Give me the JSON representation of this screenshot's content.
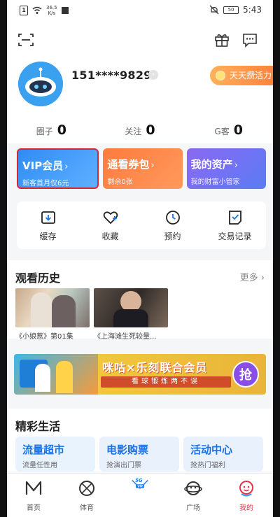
{
  "status_bar": {
    "sim": "1",
    "net_speed": "36.5\nK/s",
    "battery": "50",
    "time": "5:43"
  },
  "header": {
    "phone": "151****9829",
    "activity_label": "天天攒活力",
    "stats": [
      {
        "label": "圈子",
        "value": "0"
      },
      {
        "label": "关注",
        "value": "0"
      },
      {
        "label": "G客",
        "value": "0"
      }
    ]
  },
  "cards": [
    {
      "title": "VIP会员",
      "sub": "新客首月仅6元"
    },
    {
      "title": "通看券包",
      "sub": "剩余0张"
    },
    {
      "title": "我的资产",
      "sub": "我的财富小管家"
    }
  ],
  "quick_menu": [
    {
      "label": "缓存",
      "icon": "download-icon"
    },
    {
      "label": "收藏",
      "icon": "heart-icon"
    },
    {
      "label": "预约",
      "icon": "clock-icon"
    },
    {
      "label": "交易记录",
      "icon": "receipt-icon"
    }
  ],
  "history": {
    "title": "观看历史",
    "more": "更多",
    "items": [
      {
        "caption": "《小娘惹》第01集"
      },
      {
        "caption": "《上海滩生死较量..."
      }
    ]
  },
  "banner": {
    "title": "咪咕×乐刻联合会员",
    "strip": "看球锻炼两不误",
    "button": "抢"
  },
  "life": {
    "title": "精彩生活",
    "items": [
      {
        "title": "流量超市",
        "sub": "流量任性用"
      },
      {
        "title": "电影购票",
        "sub": "抢演出门票"
      },
      {
        "title": "活动中心",
        "sub": "抢热门福利"
      }
    ]
  },
  "tabbar": [
    {
      "label": "首页"
    },
    {
      "label": "体育"
    },
    {
      "label": "VIP",
      "badge": "5G"
    },
    {
      "label": "广场"
    },
    {
      "label": "我的"
    }
  ],
  "colors": {
    "accent": "#1a73e8",
    "active_tab": "#e8344a",
    "vip_card": "#2f8cf5",
    "ticket_card": "#ff7a3d",
    "asset_card": "#8b68f0",
    "highlight_border": "#d8282e"
  }
}
